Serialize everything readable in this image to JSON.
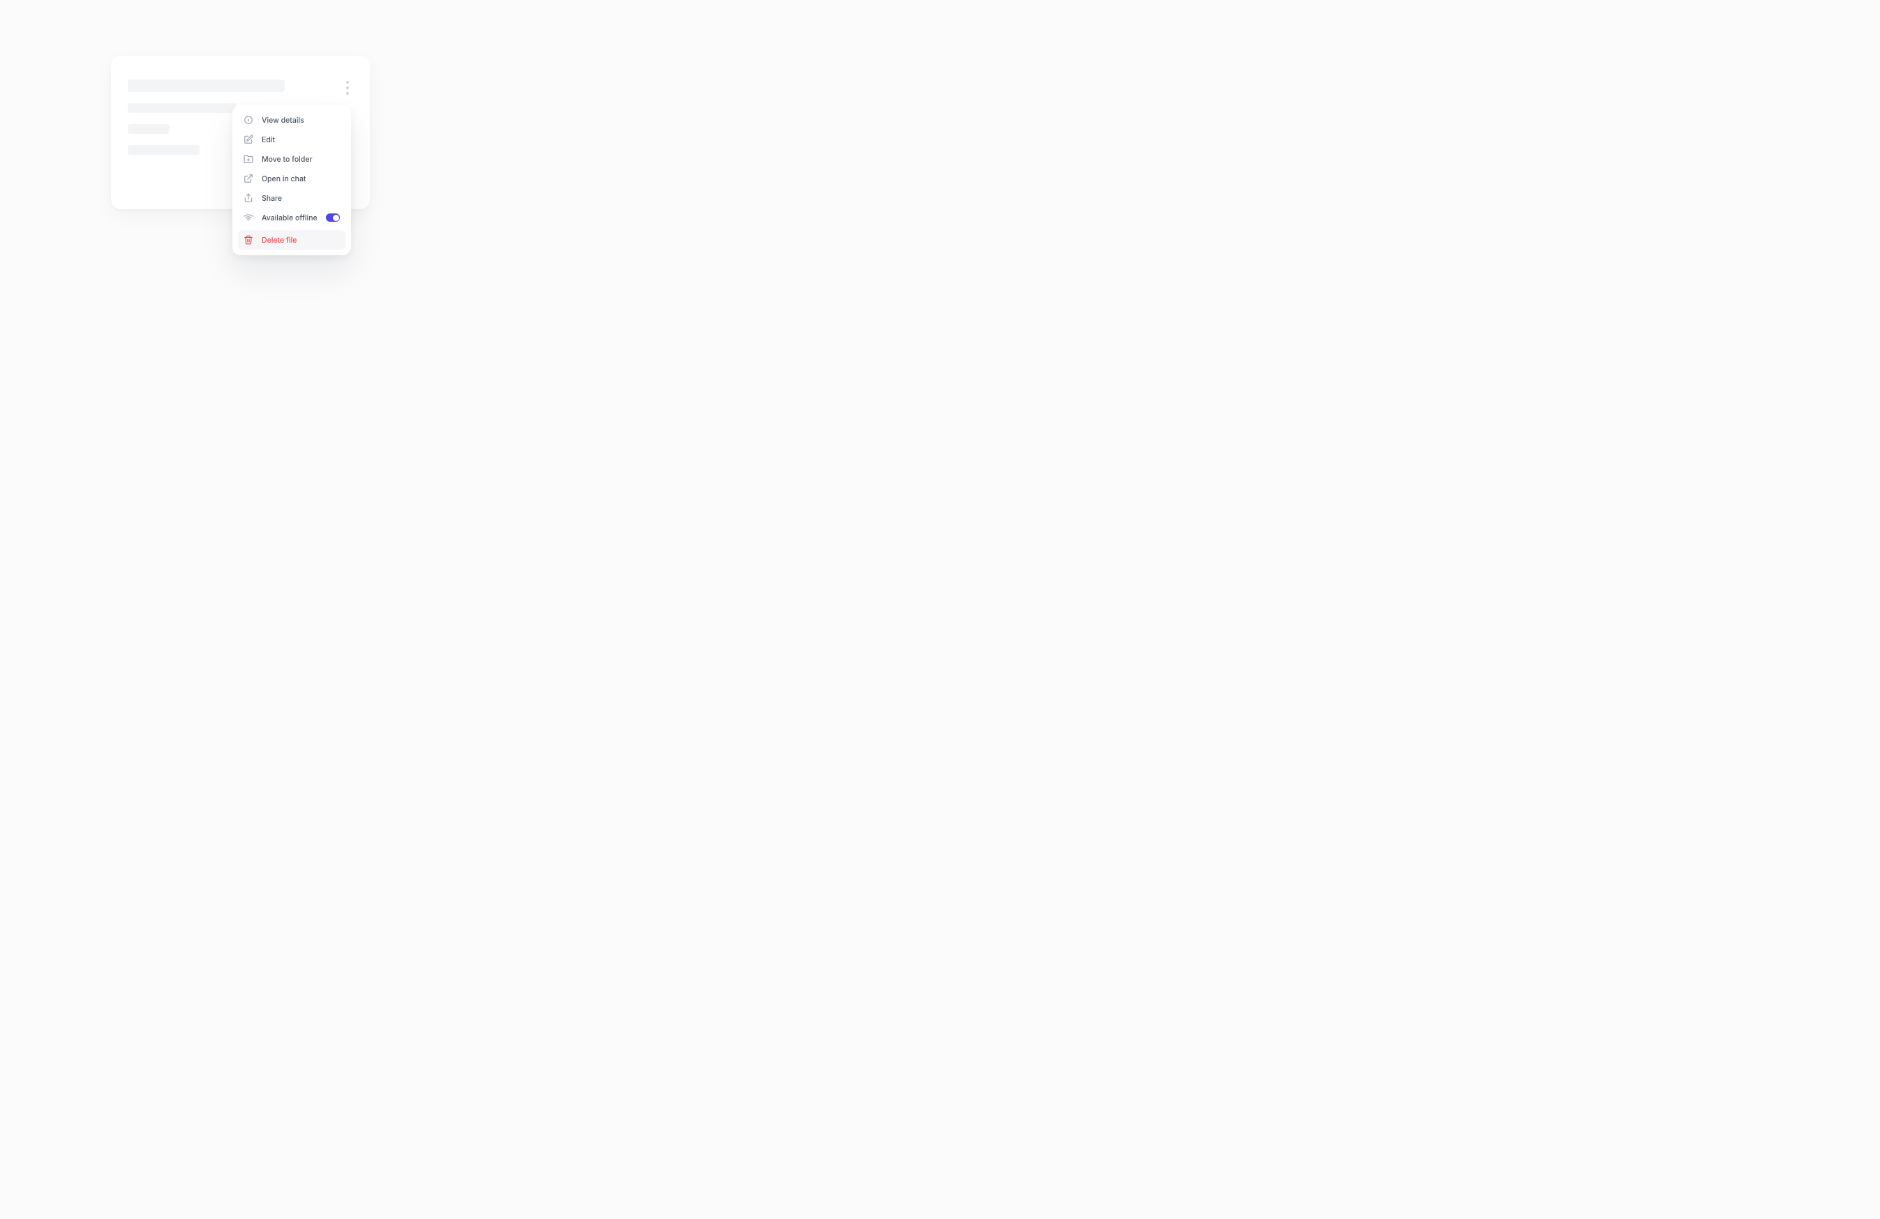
{
  "menu": {
    "items": [
      {
        "label": "View details",
        "icon": "info-icon",
        "danger": false
      },
      {
        "label": "Edit",
        "icon": "edit-icon",
        "danger": false
      },
      {
        "label": "Move to folder",
        "icon": "folder-plus-icon",
        "danger": false
      },
      {
        "label": "Open in chat",
        "icon": "external-link-icon",
        "danger": false
      },
      {
        "label": "Share",
        "icon": "share-icon",
        "danger": false
      },
      {
        "label": "Available offline",
        "icon": "wifi-icon",
        "danger": false,
        "toggle": true,
        "toggle_on": true
      },
      {
        "label": "Delete file",
        "icon": "trash-icon",
        "danger": true,
        "highlight": true
      }
    ]
  },
  "colors": {
    "accent": "#4f46e5",
    "danger": "#ef4444",
    "text_muted": "#4b5563",
    "icon_muted": "#9ca3af",
    "skeleton": "#f3f4f6"
  }
}
